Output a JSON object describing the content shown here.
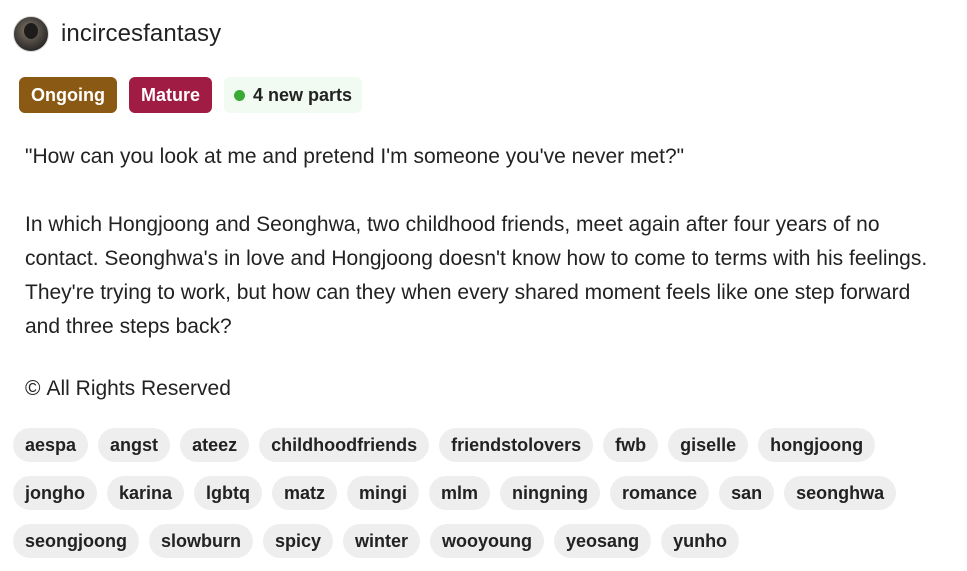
{
  "author": {
    "avatar_icon": "user-avatar",
    "name": "incircesfantasy"
  },
  "badges": {
    "status": "Ongoing",
    "rating": "Mature",
    "new_parts": "4 new parts",
    "colors": {
      "ongoing": "#8a5a14",
      "mature": "#a01c44",
      "new_dot": "#3aaa35"
    }
  },
  "description": {
    "quote": "\"How can you look at me and pretend I'm someone you've never met?\"",
    "body": "In which Hongjoong and Seonghwa, two childhood friends, meet again after four years of no contact. Seonghwa's in love and Hongjoong doesn't know how to come to terms with his feelings. They're trying to work, but how can they when every shared moment feels like one step forward and three steps back?"
  },
  "copyright": {
    "icon": "copyright-icon",
    "symbol": "©",
    "label": "All Rights Reserved"
  },
  "tags": [
    "aespa",
    "angst",
    "ateez",
    "childhoodfriends",
    "friendstolovers",
    "fwb",
    "giselle",
    "hongjoong",
    "jongho",
    "karina",
    "lgbtq",
    "matz",
    "mingi",
    "mlm",
    "ningning",
    "romance",
    "san",
    "seonghwa",
    "seongjoong",
    "slowburn",
    "spicy",
    "winter",
    "wooyoung",
    "yeosang",
    "yunho"
  ]
}
